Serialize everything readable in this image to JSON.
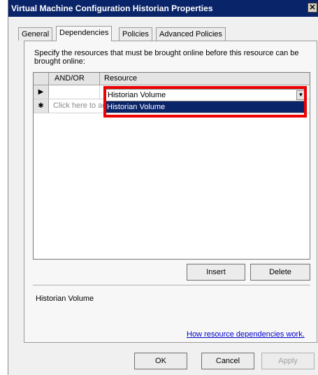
{
  "window": {
    "title": "Virtual Machine Configuration Historian Properties",
    "close_glyph": "✕"
  },
  "tabs": [
    {
      "label": "General",
      "active": false
    },
    {
      "label": "Dependencies",
      "active": true
    },
    {
      "label": "Policies",
      "active": false
    },
    {
      "label": "Advanced Policies",
      "active": false
    }
  ],
  "dependencies": {
    "description": "Specify the resources that must be brought online before this resource can be brought online:",
    "grid": {
      "columns": [
        "AND/OR",
        "Resource"
      ],
      "rows": [
        {
          "row_marker": "▶",
          "and_or": "",
          "resource": "Historian Volume"
        }
      ],
      "new_row_marker": "✱",
      "new_row_text": "Click here to ad",
      "dropdown_option": "Historian Volume"
    },
    "insert_label": "Insert",
    "delete_label": "Delete",
    "selected_resource": "Historian Volume",
    "help_link": "How resource dependencies work."
  },
  "footer": {
    "ok_label": "OK",
    "cancel_label": "Cancel",
    "apply_label": "Apply"
  },
  "colors": {
    "title_bar": "#0a246a",
    "highlight_box": "#ee0000",
    "link": "#0000cc"
  }
}
